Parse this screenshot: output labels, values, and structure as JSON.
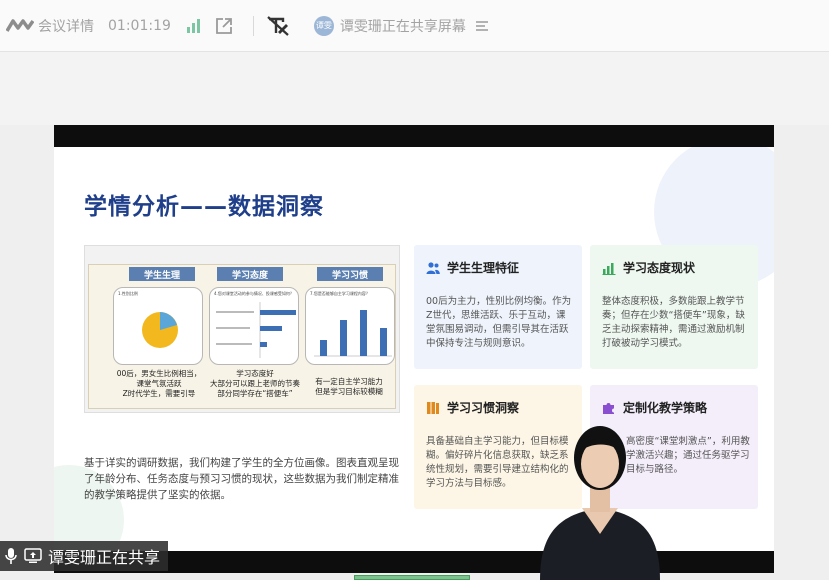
{
  "topbar": {
    "meeting_details": "会议详情",
    "duration": "01:01:19",
    "sharer_avatar": "谭雯",
    "sharing_status": "谭雯珊正在共享屏幕",
    "icons": [
      "logo-icon",
      "signal-bars-icon",
      "popout-icon",
      "no-annotation-icon",
      "list-icon"
    ]
  },
  "slide": {
    "title": "学情分析——数据洞察",
    "figure": {
      "tags": [
        "学生生理",
        "学习态度",
        "学习习惯"
      ],
      "captions": [
        [
          "00后，男女生比例相当，",
          "课堂气氛活跃",
          "Z时代学生，需要引导"
        ],
        [
          "学习态度好",
          "大部分可以跟上老师的节奏",
          "部分同学存在“搭便车”"
        ],
        [
          "有一定自主学习能力",
          "但是学习目标较模糊"
        ]
      ],
      "panel_titles": [
        "1.性别比例",
        "4.您对课堂活动的参与情况、投课感受如何？",
        "7.您是否能够自主学习课程内容？"
      ],
      "pie_values": [
        55,
        45
      ],
      "hbar_values": [
        58.33,
        33.33,
        8.33
      ],
      "vbar_values": [
        10,
        29.17,
        37.5,
        23.33
      ]
    },
    "body_text": "基于详实的调研数据，我们构建了学生的全方位画像。图表直观呈现了年龄分布、任务态度与预习习惯的现状，这些数据为我们制定精准的教学策略提供了坚实的依据。",
    "cards": [
      {
        "title": "学生生理特征",
        "icon": "users-icon",
        "color": "#eef3fc",
        "icon_color": "#2f6fd6",
        "body": "00后为主力，性别比例均衡。作为Z世代，思维活跃、乐于互动，课堂氛围易调动，但需引导其在活跃中保持专注与规则意识。"
      },
      {
        "title": "学习态度现状",
        "icon": "bar-chart-icon",
        "color": "#eef8f1",
        "icon_color": "#3aa95c",
        "body": "整体态度积极，多数能跟上教学节奏；但存在少数“搭便车”现象，缺乏主动探索精神，需通过激励机制打破被动学习模式。"
      },
      {
        "title": "学习习惯洞察",
        "icon": "books-icon",
        "color": "#fdf6e6",
        "icon_color": "#e08a1e",
        "body": "具备基础自主学习能力，但目标模糊。偏好碎片化信息获取，缺乏系统性规划，需要引导建立结构化的学习方法与目标感。"
      },
      {
        "title": "定制化教学策略",
        "icon": "puzzle-icon",
        "color": "#f4eefb",
        "icon_color": "#8a4fd1",
        "body": "高密度“课堂刺激点”，利用教学激活兴趣；通过任务驱学习目标与路径。"
      }
    ]
  },
  "bottom": {
    "sharing_label": "谭雯珊正在共享",
    "icons": [
      "microphone-icon",
      "screen-share-icon"
    ]
  }
}
